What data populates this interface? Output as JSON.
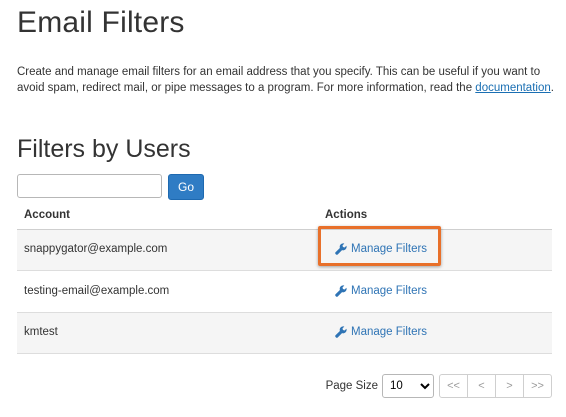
{
  "header": {
    "title": "Email Filters",
    "description": "Create and manage email filters for an email address that you specify. This can be useful if you want to avoid spam, redirect mail, or pipe messages to a program. For more information, read the ",
    "doc_link": "documentation",
    "description_end": "."
  },
  "section": {
    "title": "Filters by Users"
  },
  "search": {
    "value": "",
    "placeholder": "",
    "go_label": "Go"
  },
  "table": {
    "columns": [
      "Account",
      "Actions"
    ],
    "rows": [
      {
        "account": "snappygator@example.com",
        "action": "Manage Filters",
        "icon": "wrench-icon"
      },
      {
        "account": "testing-email@example.com",
        "action": "Manage Filters",
        "icon": "wrench-icon"
      },
      {
        "account": "kmtest",
        "action": "Manage Filters",
        "icon": "wrench-icon"
      }
    ]
  },
  "pagination": {
    "page_size_label": "Page Size",
    "page_size_value": "10",
    "buttons": [
      "<<",
      "<",
      ">",
      ">>"
    ]
  },
  "colors": {
    "primary": "#2f7cc4",
    "link": "#2f74b5",
    "highlight": "#e8702a"
  }
}
